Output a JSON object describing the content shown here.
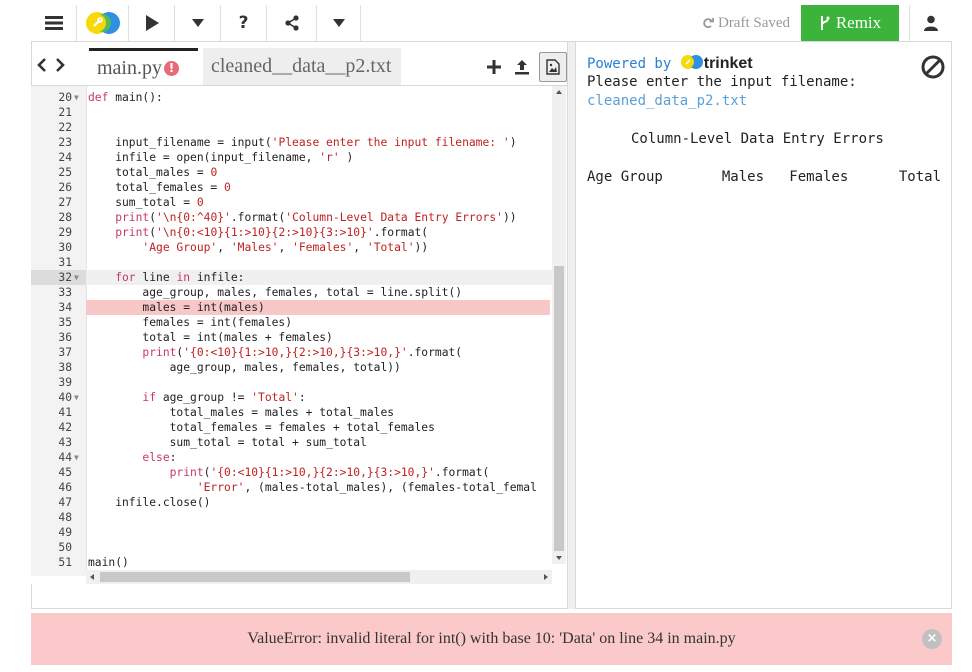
{
  "toolbar": {
    "draft_status": "Draft Saved",
    "remix_label": "Remix",
    "help_label": "?"
  },
  "tabs": [
    {
      "label": "main.py",
      "active": true,
      "has_error": true,
      "error_glyph": "!"
    },
    {
      "label": "cleaned__data__p2.txt",
      "active": false
    }
  ],
  "editor": {
    "highlighted_line": 32,
    "error_line": 34,
    "lines": [
      {
        "n": "20",
        "fold": true,
        "code": [
          [
            "k",
            "def "
          ],
          [
            "f",
            "main():"
          ]
        ]
      },
      {
        "n": "21",
        "code": []
      },
      {
        "n": "22",
        "code": []
      },
      {
        "n": "23",
        "code": [
          [
            "f",
            "    input_filename = input("
          ],
          [
            "s",
            "'Please enter the input filename: '"
          ],
          [
            "f",
            ")"
          ]
        ]
      },
      {
        "n": "24",
        "code": [
          [
            "f",
            "    infile = open(input_filename, "
          ],
          [
            "s",
            "'r'"
          ],
          [
            "f",
            " )"
          ]
        ]
      },
      {
        "n": "25",
        "code": [
          [
            "f",
            "    total_males = "
          ],
          [
            "n",
            "0"
          ]
        ]
      },
      {
        "n": "26",
        "code": [
          [
            "f",
            "    total_females = "
          ],
          [
            "n",
            "0"
          ]
        ]
      },
      {
        "n": "27",
        "code": [
          [
            "f",
            "    sum_total = "
          ],
          [
            "n",
            "0"
          ]
        ]
      },
      {
        "n": "28",
        "code": [
          [
            "k",
            "    print"
          ],
          [
            "f",
            "("
          ],
          [
            "s",
            "'\\n{0:^40}'"
          ],
          [
            "f",
            ".format("
          ],
          [
            "s",
            "'Column-Level Data Entry Errors'"
          ],
          [
            "f",
            "))"
          ]
        ]
      },
      {
        "n": "29",
        "code": [
          [
            "k",
            "    print"
          ],
          [
            "f",
            "("
          ],
          [
            "s",
            "'\\n{0:<10}{1:>10}{2:>10}{3:>10}'"
          ],
          [
            "f",
            ".format("
          ]
        ]
      },
      {
        "n": "30",
        "code": [
          [
            "f",
            "        "
          ],
          [
            "s",
            "'Age Group'"
          ],
          [
            "f",
            ", "
          ],
          [
            "s",
            "'Males'"
          ],
          [
            "f",
            ", "
          ],
          [
            "s",
            "'Females'"
          ],
          [
            "f",
            ", "
          ],
          [
            "s",
            "'Total'"
          ],
          [
            "f",
            "))"
          ]
        ]
      },
      {
        "n": "31",
        "code": []
      },
      {
        "n": "32",
        "fold": true,
        "code": [
          [
            "k",
            "    for "
          ],
          [
            "f",
            "line "
          ],
          [
            "k",
            "in "
          ],
          [
            "f",
            "infile:"
          ]
        ]
      },
      {
        "n": "33",
        "code": [
          [
            "f",
            "        age_group, males, females, total = line.split()"
          ]
        ]
      },
      {
        "n": "34",
        "code": [
          [
            "f",
            "        males = int(males)"
          ]
        ]
      },
      {
        "n": "35",
        "code": [
          [
            "f",
            "        females = int(females)"
          ]
        ]
      },
      {
        "n": "36",
        "code": [
          [
            "f",
            "        total = int(males + females)"
          ]
        ]
      },
      {
        "n": "37",
        "code": [
          [
            "k",
            "        print"
          ],
          [
            "f",
            "("
          ],
          [
            "s",
            "'{0:<10}{1:>10,}{2:>10,}{3:>10,}'"
          ],
          [
            "f",
            ".format("
          ]
        ]
      },
      {
        "n": "38",
        "code": [
          [
            "f",
            "            age_group, males, females, total))"
          ]
        ]
      },
      {
        "n": "39",
        "code": []
      },
      {
        "n": "40",
        "fold": true,
        "code": [
          [
            "k",
            "        if "
          ],
          [
            "f",
            "age_group != "
          ],
          [
            "s",
            "'Total'"
          ],
          [
            "f",
            ":"
          ]
        ]
      },
      {
        "n": "41",
        "code": [
          [
            "f",
            "            total_males = males + total_males"
          ]
        ]
      },
      {
        "n": "42",
        "code": [
          [
            "f",
            "            total_females = females + total_females"
          ]
        ]
      },
      {
        "n": "43",
        "code": [
          [
            "f",
            "            sum_total = total + sum_total"
          ]
        ]
      },
      {
        "n": "44",
        "fold": true,
        "code": [
          [
            "k",
            "        else"
          ],
          [
            "f",
            ":"
          ]
        ]
      },
      {
        "n": "45",
        "code": [
          [
            "k",
            "            print"
          ],
          [
            "f",
            "("
          ],
          [
            "s",
            "'{0:<10}{1:>10,}{2:>10,}{3:>10,}'"
          ],
          [
            "f",
            ".format("
          ]
        ]
      },
      {
        "n": "46",
        "code": [
          [
            "f",
            "                "
          ],
          [
            "s",
            "'Error'"
          ],
          [
            "f",
            ", (males-total_males), (females-total_femal"
          ]
        ]
      },
      {
        "n": "47",
        "code": [
          [
            "f",
            "    infile.close()"
          ]
        ]
      },
      {
        "n": "48",
        "code": []
      },
      {
        "n": "49",
        "code": []
      },
      {
        "n": "50",
        "code": []
      },
      {
        "n": "51",
        "code": [
          [
            "f",
            "main()"
          ]
        ]
      }
    ]
  },
  "output": {
    "powered_by": "Powered by",
    "brand": "trinket",
    "prompt": "Please enter the input filename:",
    "input_value": "cleaned_data_p2.txt",
    "title_line": "Column-Level Data Entry Errors",
    "header_line": "Age Group       Males   Females      Total"
  },
  "error_bar": {
    "message": "ValueError: invalid literal for int() with base 10: 'Data' on line 34 in main.py",
    "close_glyph": "×"
  },
  "colors": {
    "remix_bg": "#3cb43c",
    "error_bg": "#fbc9c9",
    "error_line_bg": "#f8c8c8",
    "keyword": "#c8376b",
    "string": "#c02121",
    "link": "#2a7fd4"
  }
}
